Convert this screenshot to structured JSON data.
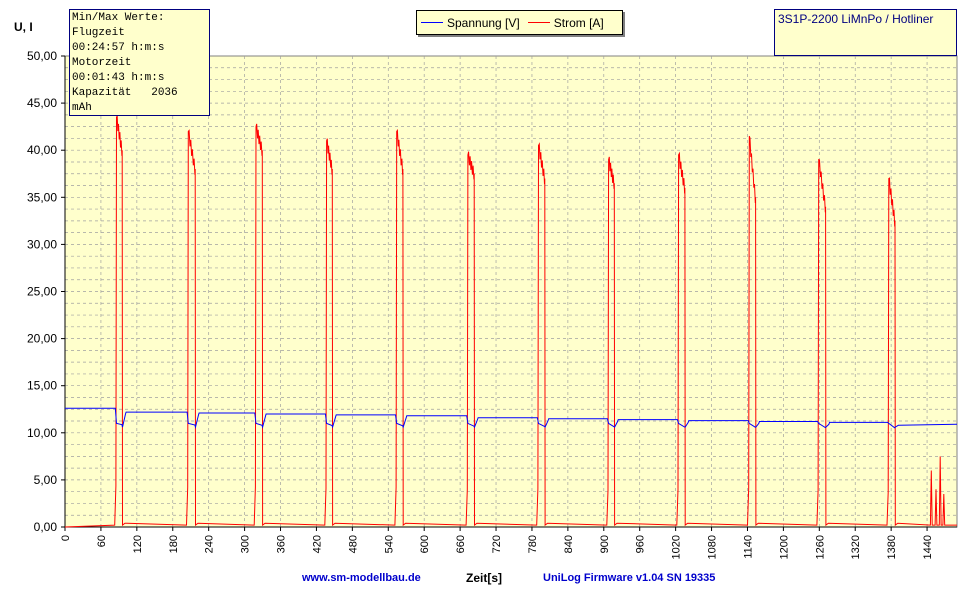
{
  "stats_box": {
    "lines": [
      "Min/Max Werte:",
      "Flugzeit",
      "00:24:57 h:m:s",
      "Motorzeit",
      "00:01:43 h:m:s",
      "Kapazität   2036",
      "mAh"
    ]
  },
  "legend": {
    "items": [
      {
        "label": "Spannung [V]",
        "color": "#0000ff"
      },
      {
        "label": "Strom [A]",
        "color": "#ff0000"
      }
    ]
  },
  "model_label": "3S1P-2200 LiMnPo / Hotliner",
  "footer": {
    "website": "www.sm-modellbau.de",
    "xlabel": "Zeit[s]",
    "firmware": "UniLog Firmware v1.04 SN 19335"
  },
  "colors": {
    "plot_bg": "#ffffcc",
    "grid": "#a0a0a0",
    "voltage": "#0000ff",
    "current": "#ff0000",
    "footer_blue": "#0000cc"
  },
  "chart_data": {
    "type": "line",
    "title": "",
    "xlabel": "Zeit[s]",
    "ylabel": "U, I",
    "xlim": [
      0,
      1490
    ],
    "ylim": [
      0,
      50
    ],
    "x_ticks": [
      0,
      60,
      120,
      180,
      240,
      300,
      360,
      420,
      480,
      540,
      600,
      660,
      720,
      780,
      840,
      900,
      960,
      1020,
      1080,
      1140,
      1200,
      1260,
      1320,
      1380,
      1440
    ],
    "y_ticks": [
      "0,00",
      "5,00",
      "10,00",
      "15,00",
      "20,00",
      "25,00",
      "30,00",
      "35,00",
      "40,00",
      "45,00",
      "50,00"
    ],
    "grid": true,
    "legend_position": "top-center",
    "bursts": [
      {
        "start": 85,
        "end": 96,
        "peak": 43.5,
        "end_current": 40.0
      },
      {
        "start": 205,
        "end": 218,
        "peak": 42.0,
        "end_current": 38.0
      },
      {
        "start": 318,
        "end": 330,
        "peak": 42.5,
        "end_current": 40.0
      },
      {
        "start": 436,
        "end": 447,
        "peak": 41.0,
        "end_current": 38.0
      },
      {
        "start": 553,
        "end": 565,
        "peak": 42.0,
        "end_current": 38.0
      },
      {
        "start": 672,
        "end": 684,
        "peak": 39.5,
        "end_current": 37.5
      },
      {
        "start": 790,
        "end": 802,
        "peak": 40.5,
        "end_current": 37.0
      },
      {
        "start": 907,
        "end": 918,
        "peak": 39.0,
        "end_current": 36.5
      },
      {
        "start": 1024,
        "end": 1036,
        "peak": 39.5,
        "end_current": 36.0
      },
      {
        "start": 1142,
        "end": 1154,
        "peak": 41.5,
        "end_current": 35.0
      },
      {
        "start": 1258,
        "end": 1271,
        "peak": 39.0,
        "end_current": 34.0
      },
      {
        "start": 1375,
        "end": 1387,
        "peak": 37.0,
        "end_current": 32.5
      }
    ],
    "series": [
      {
        "name": "Spannung [V]",
        "rest_levels": [
          12.6,
          12.2,
          12.1,
          12.0,
          11.9,
          11.8,
          11.6,
          11.5,
          11.4,
          11.3,
          11.2,
          11.1,
          11.0,
          10.8
        ],
        "load_level_start": 11.0,
        "load_level_end": 10.2
      },
      {
        "name": "Strom [A]",
        "idle": 0.2,
        "end_spikes": [
          {
            "x": 1447,
            "y": 6.0
          },
          {
            "x": 1455,
            "y": 4.0
          },
          {
            "x": 1462,
            "y": 7.5
          },
          {
            "x": 1468,
            "y": 3.5
          }
        ]
      }
    ]
  }
}
